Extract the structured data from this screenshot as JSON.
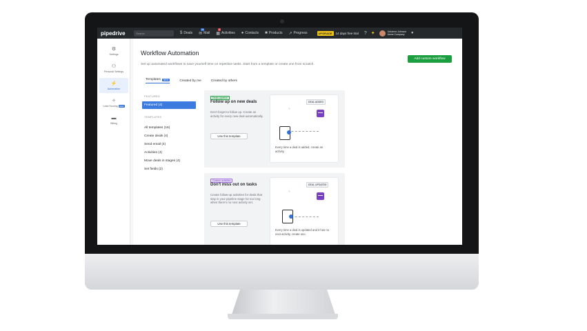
{
  "topbar": {
    "logo": "pipedrive",
    "search_placeholder": "Search",
    "nav": [
      {
        "label": "Deals",
        "icon": "deals-icon"
      },
      {
        "label": "Mail",
        "icon": "mail-icon",
        "badge": "25"
      },
      {
        "label": "Activities",
        "icon": "activities-icon",
        "badge": "3"
      },
      {
        "label": "Contacts",
        "icon": "contacts-icon"
      },
      {
        "label": "Products",
        "icon": "products-icon"
      },
      {
        "label": "Progress",
        "icon": "progress-icon"
      }
    ],
    "upgrade_label": "UPGRADE",
    "upgrade_text": "14 days free trial",
    "user_name": "Johanna Johnson",
    "user_company": "Acme Company"
  },
  "rail": [
    {
      "label": "Settings",
      "icon": "gear-icon"
    },
    {
      "label": "Personal Settings",
      "icon": "person-settings-icon"
    },
    {
      "label": "Automation",
      "icon": "automation-icon",
      "active": true
    },
    {
      "label": "Lead Scoring",
      "icon": "sparkle-icon",
      "tag": "NEW"
    },
    {
      "label": "Billing",
      "icon": "billing-icon"
    }
  ],
  "main": {
    "title": "Workflow Automation",
    "subtitle": "Set up automated workflows to save yourself time on repetitive tasks. Start from a template or create one from scratch.",
    "add_button": "Add custom workflow",
    "tabs": [
      {
        "label": "Templates",
        "tag": "NEW",
        "active": true
      },
      {
        "label": "Created by me"
      },
      {
        "label": "Created by others"
      }
    ]
  },
  "categories": {
    "featured_header": "FEATURED",
    "featured": [
      {
        "label": "Featured (4)",
        "active": true
      }
    ],
    "templates_header": "TEMPLATES",
    "items": [
      {
        "label": "All templates (16)"
      },
      {
        "label": "Create deals (4)"
      },
      {
        "label": "Send email (4)"
      },
      {
        "label": "Activities (4)"
      },
      {
        "label": "Move deals in stages (4)"
      },
      {
        "label": "Set fields (2)"
      }
    ]
  },
  "cards": [
    {
      "tag": "Deals pipeline",
      "title": "Follow up on new deals",
      "description": "Don't forget to follow up. Create an activity for every new deal automatically.",
      "button": "Use this template",
      "preview_badge": "DEAL ADDED",
      "preview_text": "Every time a deal is added, create an activity."
    },
    {
      "tag": "Custom activities",
      "title": "Don't miss out on tasks",
      "description": "Create follow-up activities for deals that stay in your pipeline stage for too long when there's no next activity set.",
      "button": "Use this template",
      "preview_badge": "DEAL UPDATED",
      "preview_text": "Every time a deal is updated and it has no next activity, create one."
    }
  ]
}
